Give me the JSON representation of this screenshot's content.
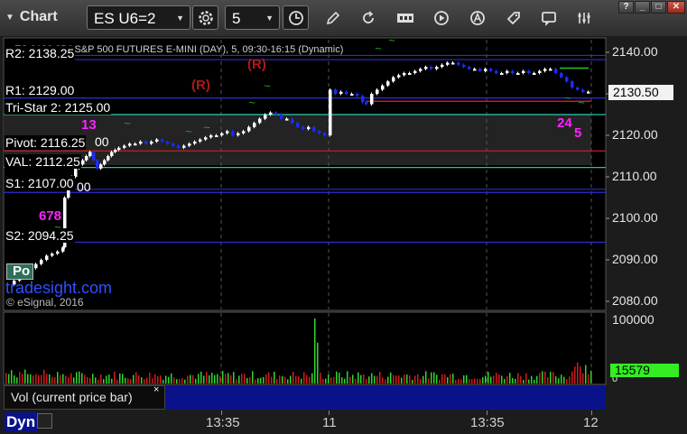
{
  "toolbar": {
    "title": "Chart",
    "symbol": "ES U6=2",
    "interval": "5",
    "icons": [
      "gear-icon",
      "clock-icon",
      "pencil-icon",
      "refresh-icon",
      "get-icon",
      "play-icon",
      "a-circle-icon",
      "tag-icon",
      "comment-icon",
      "settings-icon"
    ],
    "window_controls": [
      "?",
      "_",
      "□",
      "✕"
    ]
  },
  "chart": {
    "series_title": "ES 2138.25 | S&P 500 FUTURES E-MINI (DAY), 5, 09:30-16:15 (Dynamic)",
    "y_ticks": [
      "2140.00",
      "2130.00",
      "2120.00",
      "2110.00",
      "2100.00",
      "2090.00",
      "2080.00"
    ],
    "last_price": "2130.50",
    "levels": [
      {
        "label": "R2: 2138.25"
      },
      {
        "label": "R1: 2129.00"
      },
      {
        "label": "Tri-Star 2: 2125.00"
      },
      {
        "label": "Pivot: 2116.25"
      },
      {
        "label": "VAL: 2112.25"
      },
      {
        "label": "S1: 2107.00"
      },
      {
        "label": "S2: 2094.25"
      }
    ],
    "markers": {
      "r1": "(R)",
      "r2": "(R)",
      "m13": "13",
      "m678": "678",
      "m24": "24",
      "m5": "5",
      "po": "Po",
      "val_partial": "00",
      "s1_partial": "00"
    },
    "watermark": "tradesight.com",
    "copyright": "© eSignal, 2016",
    "colors": {
      "r_level": "#2c2cd8",
      "tristar": "#26c0a8",
      "pivot": "#c81e1e",
      "s_level": "#2c2cd8",
      "up_candle": "#ffffff",
      "down_candle": "#1a2cff",
      "marker_magenta": "#ff22ff",
      "marker_green": "#1faa2a",
      "marker_red": "#c11515"
    }
  },
  "volume": {
    "header": "Vol (current price bar)",
    "close_icon": "×",
    "y_ticks": [
      "100000",
      "0"
    ],
    "last_value": "15579"
  },
  "xaxis": {
    "labels": [
      "13:35",
      "11",
      "13:35",
      "12"
    ]
  },
  "bottom": {
    "label": "Dyn"
  }
}
